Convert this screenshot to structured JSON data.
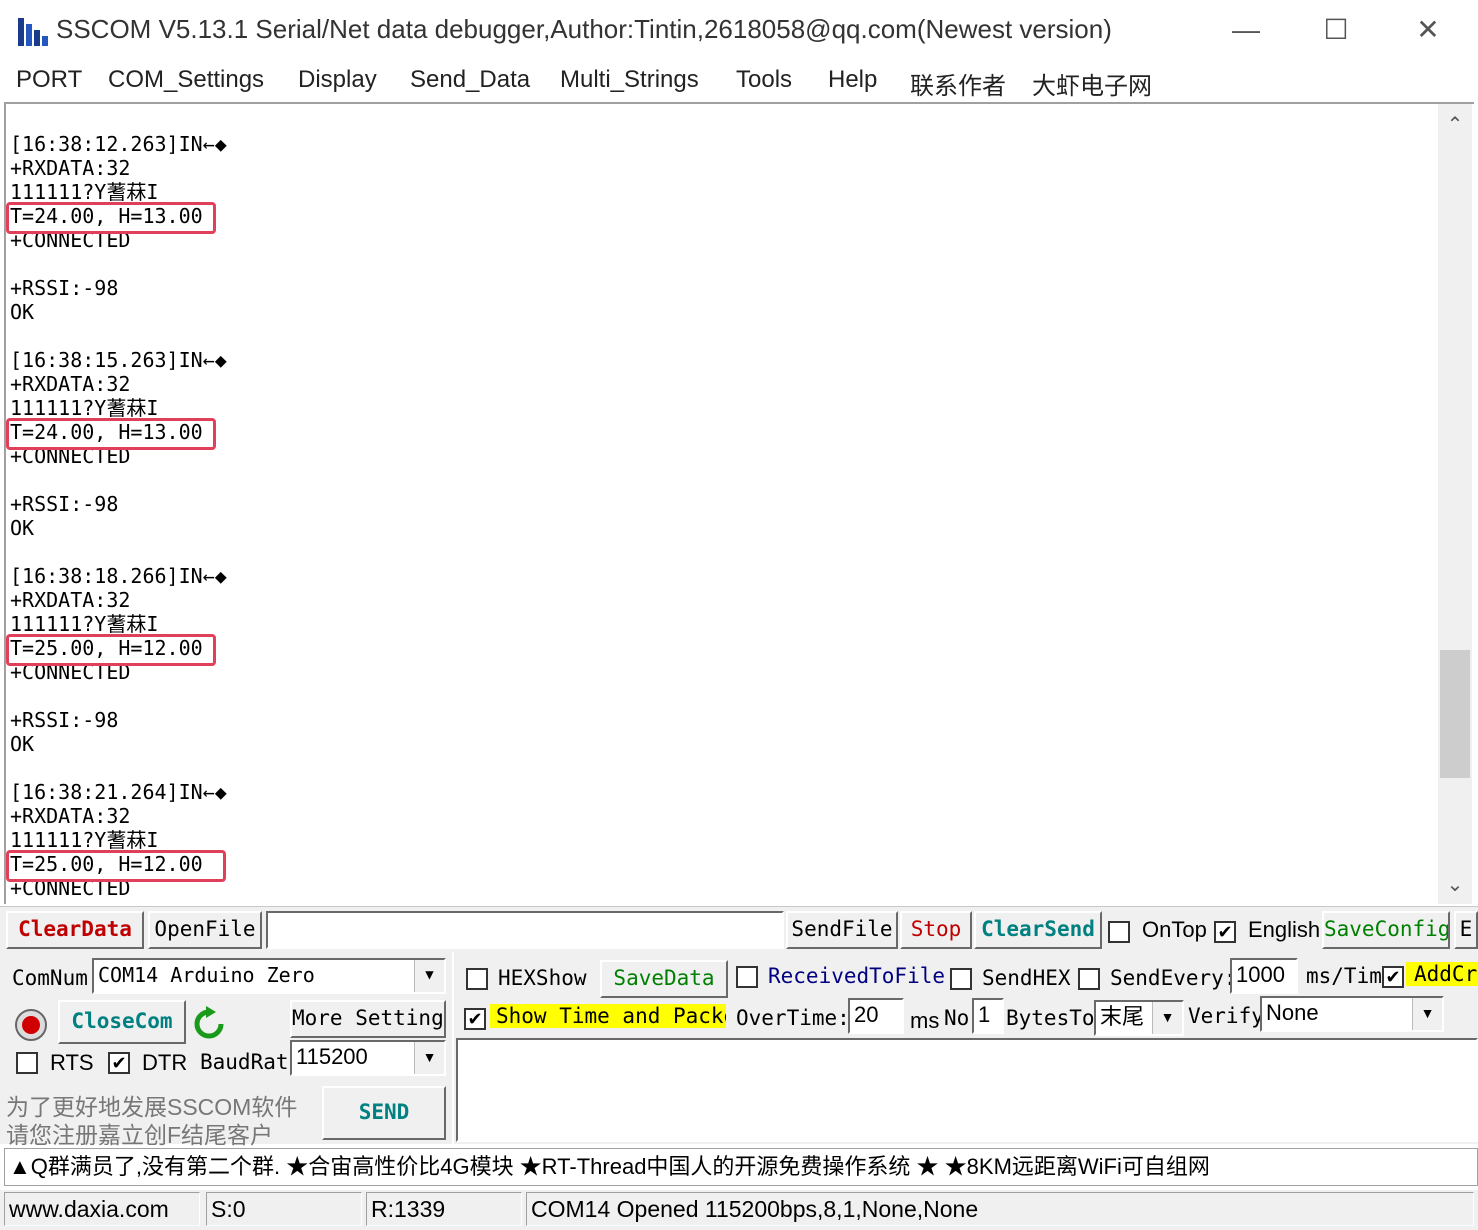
{
  "window": {
    "title": "SSCOM V5.13.1 Serial/Net data debugger,Author:Tintin,2618058@qq.com(Newest version)",
    "minimize_icon": "minimize-icon",
    "maximize_icon": "maximize-icon",
    "close_icon": "close-icon"
  },
  "menu": [
    "PORT",
    "COM_Settings",
    "Display",
    "Send_Data",
    "Multi_Strings",
    "Tools",
    "Help",
    "联系作者",
    "大虾电子网"
  ],
  "receive": {
    "lines": [
      "[16:38:12.263]IN←◆",
      "+RXDATA:32",
      "111111?Y蓍菻I",
      "T=24.00, H=13.00",
      "+CONNECTED",
      "",
      "+RSSI:-98",
      "OK",
      "",
      "[16:38:15.263]IN←◆",
      "+RXDATA:32",
      "111111?Y蓍菻I",
      "T=24.00, H=13.00",
      "+CONNECTED",
      "",
      "+RSSI:-98",
      "OK",
      "",
      "[16:38:18.266]IN←◆",
      "+RXDATA:32",
      "111111?Y蓍菻I",
      "T=25.00, H=12.00",
      "+CONNECTED",
      "",
      "+RSSI:-98",
      "OK",
      "",
      "[16:38:21.264]IN←◆",
      "+RXDATA:32",
      "111111?Y蓍菻I",
      "T=25.00, H=12.00",
      "+CONNECTED"
    ],
    "highlight_color": "#e0405a"
  },
  "toolbar1": {
    "clear_data": "ClearData",
    "open_file": "OpenFile",
    "file_path": "",
    "send_file": "SendFile",
    "stop": "Stop",
    "clear_send": "ClearSend",
    "on_top": "OnTop",
    "on_top_checked": false,
    "english": "English",
    "english_checked": true,
    "save_config": "SaveConfig",
    "ext": "E"
  },
  "port": {
    "com_num_label": "ComNum",
    "com_num_value": "COM14 Arduino Zero",
    "close_com": "CloseCom",
    "more_settings": "More Settings",
    "rts": "RTS",
    "rts_checked": false,
    "dtr": "DTR",
    "dtr_checked": true,
    "baud_label": "BaudRat",
    "baud_value": "115200",
    "promo_line1": "为了更好地发展SSCOM软件",
    "promo_line2": "请您注册嘉立创F结尾客户",
    "send": "SEND"
  },
  "options": {
    "hex_show": "HEXShow",
    "hex_show_checked": false,
    "save_data": "SaveData",
    "received_to_file": "ReceivedToFile",
    "received_to_file_checked": false,
    "send_hex": "SendHEX",
    "send_hex_checked": false,
    "send_every": "SendEvery:",
    "send_every_checked": false,
    "send_every_value": "1000",
    "ms_tim": "ms/Tim",
    "add_cr_checked": true,
    "add_cr": "AddCr",
    "show_time": "Show Time and Packe",
    "show_time_checked": true,
    "over_time": "OverTime:",
    "over_time_value": "20",
    "ms": "ms",
    "no": "No",
    "no_value": "1",
    "bytes_to": "BytesTo",
    "bytes_to_value": "末尾",
    "verify": "Verify",
    "verify_value": "None"
  },
  "ad": "▲Q群满员了,没有第二个群. ★合宙高性价比4G模块 ★RT-Thread中国人的开源免费操作系统 ★ ★8KM远距离WiFi可自组网",
  "status": {
    "website": "www.daxia.com",
    "sent": "S:0",
    "received": "R:1339",
    "port_state": "COM14 Opened  115200bps,8,1,None,None"
  },
  "colors": {
    "accent_red": "#c00000",
    "accent_green": "#008000",
    "accent_blue": "#000080",
    "highlight_yellow": "#ffff00"
  }
}
